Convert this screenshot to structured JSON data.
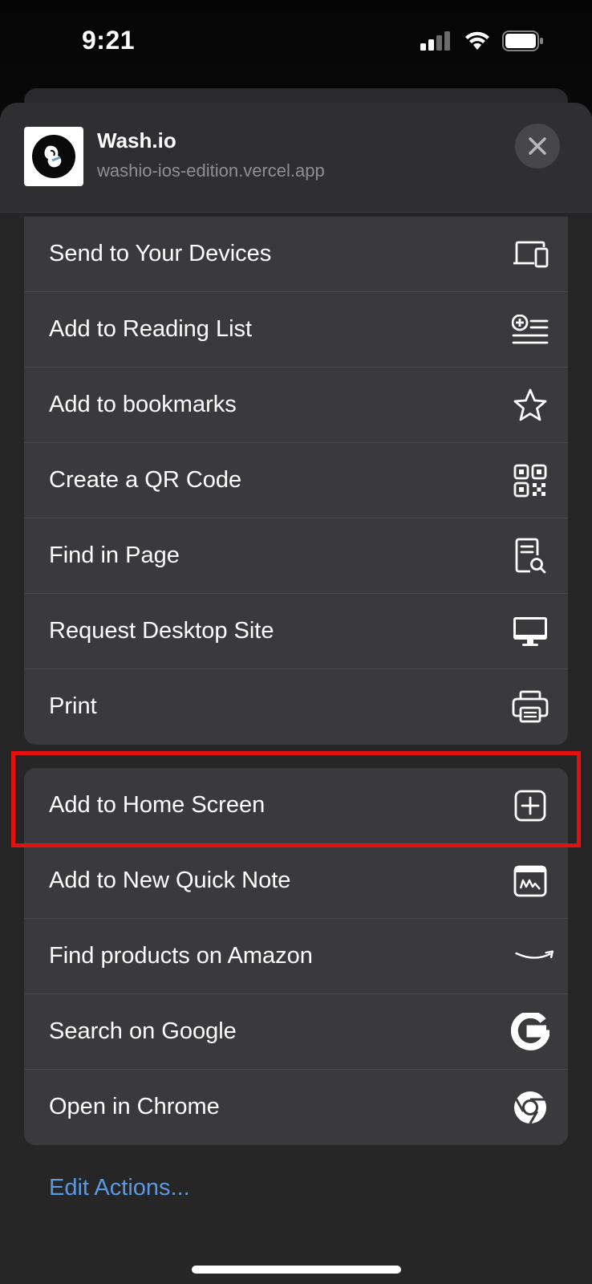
{
  "status_bar": {
    "time": "9:21"
  },
  "header": {
    "app_title": "Wash.io",
    "app_url": "washio-ios-edition.vercel.app"
  },
  "group_one": [
    {
      "label": "Send to Your Devices",
      "icon": "devices-icon"
    },
    {
      "label": "Add to Reading List",
      "icon": "reading-list-icon"
    },
    {
      "label": "Add to bookmarks",
      "icon": "star-icon"
    },
    {
      "label": "Create a QR Code",
      "icon": "qr-code-icon"
    },
    {
      "label": "Find in Page",
      "icon": "find-in-page-icon"
    },
    {
      "label": "Request Desktop Site",
      "icon": "desktop-icon"
    },
    {
      "label": "Print",
      "icon": "printer-icon"
    }
  ],
  "group_two": [
    {
      "label": "Add to Home Screen",
      "icon": "add-square-icon"
    },
    {
      "label": "Add to New Quick Note",
      "icon": "quick-note-icon"
    },
    {
      "label": "Find products on Amazon",
      "icon": "amazon-icon"
    },
    {
      "label": "Search on Google",
      "icon": "google-icon"
    },
    {
      "label": "Open in Chrome",
      "icon": "chrome-icon"
    }
  ],
  "edit_actions": "Edit Actions...",
  "colors": {
    "highlight": "#e3100f",
    "link": "#5a98e4",
    "row_bg": "#3a3a3c"
  }
}
